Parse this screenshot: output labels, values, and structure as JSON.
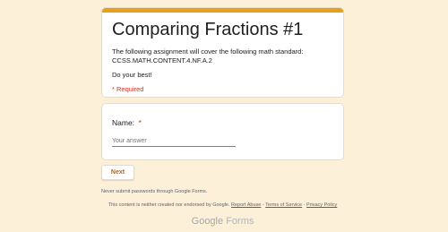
{
  "form": {
    "title": "Comparing Fractions #1",
    "description_line1": "The following assignment will cover the following math standard:",
    "description_line2": "CCSS.MATH.CONTENT.4.NF.A.2",
    "description_line3": "Do your best!",
    "required_note": "* Required"
  },
  "question": {
    "label": "Name:",
    "required_marker": "*",
    "placeholder": "Your answer",
    "value": ""
  },
  "buttons": {
    "next_label": "Next"
  },
  "footer": {
    "never_submit": "Never submit passwords through Google Forms.",
    "disclaimer_prefix": "This content is neither created nor endorsed by Google.",
    "report_abuse": "Report Abuse",
    "separator": "-",
    "terms": "Terms of Service",
    "privacy": "Privacy Policy",
    "logo_brand": "Google",
    "logo_product": "Forms"
  },
  "colors": {
    "background": "#fdf0d8",
    "accent": "#e8a01a",
    "button_text": "#b8631b",
    "required": "#d93025"
  }
}
